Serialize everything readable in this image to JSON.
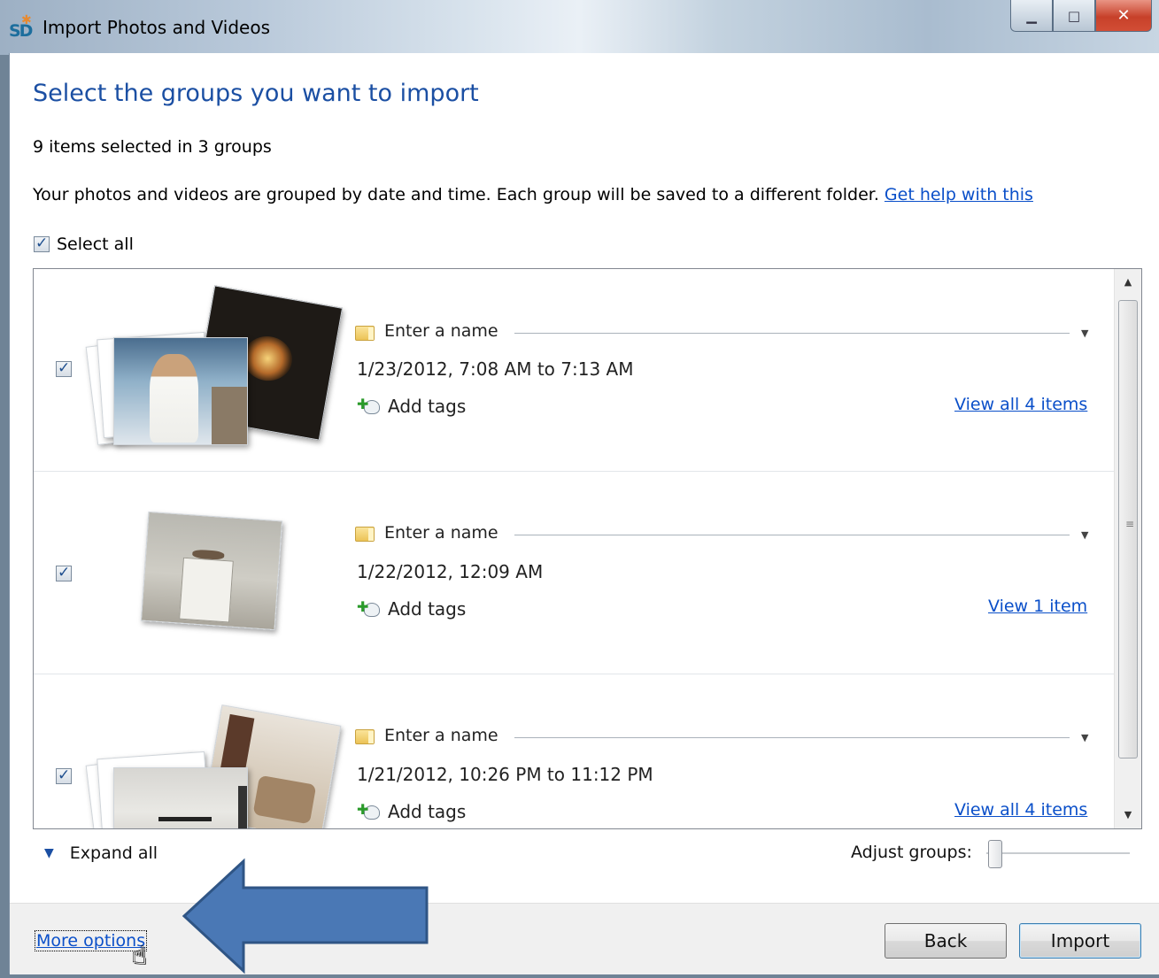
{
  "window": {
    "title": "Import Photos and Videos",
    "minimize": "▁",
    "maximize": "□",
    "close": "✕"
  },
  "heading": "Select the groups you want to import",
  "selection_summary": "9 items selected in 3 groups",
  "description": "Your photos and videos are grouped by date and time. Each group will be saved to a different folder.",
  "help_link": "Get help with this",
  "select_all": {
    "label": "Select all",
    "checked": true
  },
  "groups": [
    {
      "checked": true,
      "name_placeholder": "Enter a name",
      "date": "1/23/2012, 7:08 AM to 7:13 AM",
      "tags_label": "Add tags",
      "view_link": "View all 4 items"
    },
    {
      "checked": true,
      "name_placeholder": "Enter a name",
      "date": "1/22/2012, 12:09 AM",
      "tags_label": "Add tags",
      "view_link": "View 1 item"
    },
    {
      "checked": true,
      "name_placeholder": "Enter a name",
      "date": "1/21/2012, 10:26 PM to 11:12 PM",
      "tags_label": "Add tags",
      "view_link": "View all 4 items"
    }
  ],
  "expand_all": "Expand all",
  "adjust_groups": "Adjust groups:",
  "more_options": "More options",
  "buttons": {
    "back": "Back",
    "import": "Import"
  },
  "colors": {
    "heading": "#1b4fa3",
    "link": "#0a4fc9",
    "annotation_arrow": "#4a78b5"
  }
}
